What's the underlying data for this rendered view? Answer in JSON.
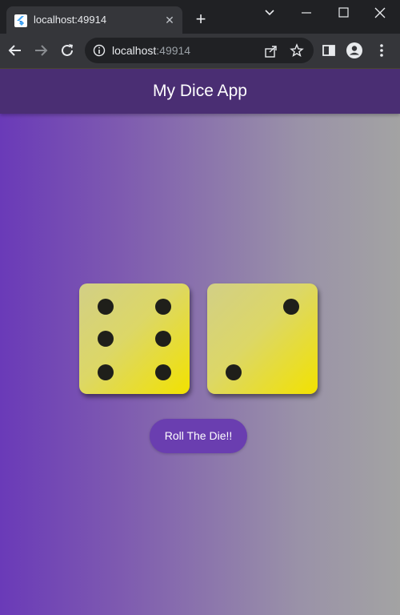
{
  "browser": {
    "tab": {
      "title": "localhost:49914",
      "favicon": "flutter-icon"
    },
    "address": {
      "host": "localhost",
      "port_suffix": ":49914"
    }
  },
  "app": {
    "title": "My Dice App",
    "dice": [
      {
        "value": 6
      },
      {
        "value": 2
      }
    ],
    "roll_button_label": "Roll The Die!!"
  },
  "colors": {
    "appbar": "#4a2e73",
    "gradient_start": "#6a3ab8",
    "gradient_end": "#a3a3a3",
    "die_face": "#dcd767",
    "pip": "#1f1f1a",
    "button": "#6a3eb0"
  }
}
